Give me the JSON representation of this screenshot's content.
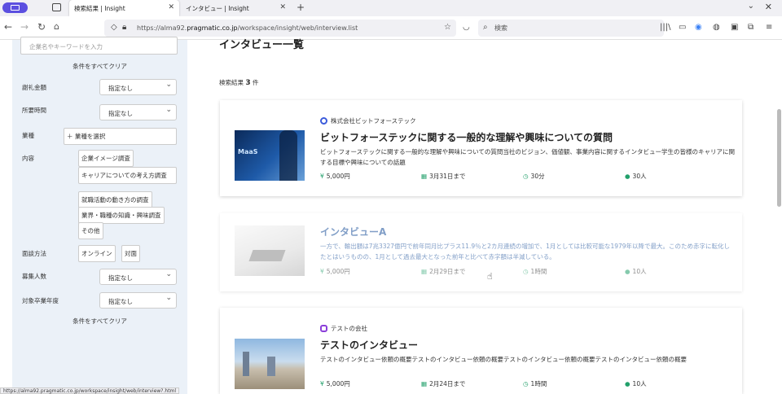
{
  "browser": {
    "tabs": [
      {
        "label": "検索結果 | Insight",
        "active": true
      },
      {
        "label": "インタビュー | Insight",
        "active": false
      }
    ],
    "url_prefix": "https://alma92.",
    "url_domain": "pragmatic.co.jp",
    "url_path": "/workspace/insight/web/interview.list",
    "search_placeholder": "検索",
    "status_url": "https://alma92.pragmatic.co.jp/workspace/insight/web/interview?.html"
  },
  "sidebar": {
    "keyword_placeholder": "企業名やキーワードを入力",
    "clear_label": "条件をすべてクリア",
    "reward_label": "謝礼金額",
    "reward_value": "指定なし",
    "duration_label": "所要時間",
    "duration_value": "指定なし",
    "industry_label": "業種",
    "industry_button": "＋ 業種を選択",
    "content_label": "内容",
    "content_options": [
      "企業イメージ調査",
      "キャリアについての考え方調査",
      "就職活動の動き方の調査",
      "業界・職種の知識・興味調査",
      "その他"
    ],
    "method_label": "面談方法",
    "method_options": [
      "オンライン",
      "対面"
    ],
    "recruit_label": "募集人数",
    "recruit_value": "指定なし",
    "grad_label": "対象卒業年度",
    "grad_value": "指定なし",
    "clear_label_bottom": "条件をすべてクリア"
  },
  "main": {
    "title": "インタビュー一覧",
    "count_prefix": "検索結果",
    "count": "3",
    "count_suffix": "件",
    "cards": [
      {
        "company": "株式会社ビットフォーステック",
        "title": "ビットフォーステックに関する一般的な理解や興味についての質問",
        "desc": "ビットフォーステックに関する一般的な理解や興味についての質問当社のビジョン、価値観、事業内容に関するインタビュー学生の皆様のキャリアに関する目標や興味についての話題",
        "reward": "5,000円",
        "deadline": "3月31日まで",
        "duration": "30分",
        "people": "30人",
        "thumb_text": "MaaS"
      },
      {
        "company": "",
        "title": "インタビューA",
        "desc": "一方で、輸出額は7兆3327億円で前年同月比プラス11.9％と2カ月連続の増加で、1月としては比較可能な1979年以降で最大。このため赤字に転化したとはいうものの、1月として過去最大となった前年と比べて赤字額は半減している。",
        "reward": "5,000円",
        "deadline": "2月29日まで",
        "duration": "1時間",
        "people": "10人"
      },
      {
        "company": "テストの会社",
        "title": "テストのインタビュー",
        "desc": "テストのインタビュー依頼の概要テストのインタビュー依頼の概要テストのインタビュー依頼の概要テストのインタビュー依頼の概要",
        "reward": "5,000円",
        "deadline": "2月24日まで",
        "duration": "1時間",
        "people": "10人"
      }
    ]
  }
}
